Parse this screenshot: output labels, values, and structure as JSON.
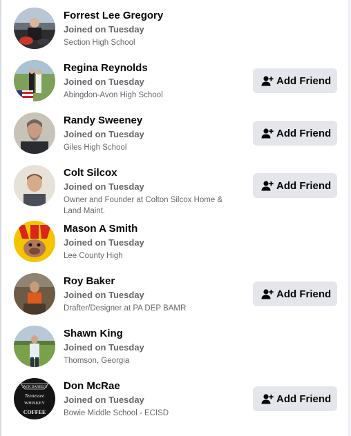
{
  "people": [
    {
      "name": "Forrest Lee Gregory",
      "joined": "Joined on Tuesday",
      "meta": "Section High School",
      "show_add": false,
      "add_label": "Add Friend"
    },
    {
      "name": "Regina Reynolds",
      "joined": "Joined on Tuesday",
      "meta": "Abingdon-Avon High School",
      "show_add": true,
      "add_label": "Add Friend"
    },
    {
      "name": "Randy Sweeney",
      "joined": "Joined on Tuesday",
      "meta": "Giles High School",
      "show_add": true,
      "add_label": "Add Friend"
    },
    {
      "name": "Colt Silcox",
      "joined": "Joined on Tuesday",
      "meta": "Owner and Founder at Colton Silcox Home & Land Maint.",
      "show_add": true,
      "add_label": "Add Friend"
    },
    {
      "name": "Mason A Smith",
      "joined": "Joined on Tuesday",
      "meta": "Lee County High",
      "show_add": false,
      "add_label": "Add Friend"
    },
    {
      "name": "Roy Baker",
      "joined": "Joined on Tuesday",
      "meta": "Drafter/Designer at PA DEP BAMR",
      "show_add": true,
      "add_label": "Add Friend"
    },
    {
      "name": "Shawn King",
      "joined": "Joined on Tuesday",
      "meta": "Thomson, Georgia",
      "show_add": false,
      "add_label": "Add Friend"
    },
    {
      "name": "Don McRae",
      "joined": "Joined on Tuesday",
      "meta": "Bowie Middle School - ECISD",
      "show_add": true,
      "add_label": "Add Friend"
    }
  ],
  "avatar_logo_text": {
    "line1": "JACK DANIEL'S",
    "line2": "Tennessee",
    "line3": "WHISKEY",
    "line4": "COFFEE"
  },
  "colors": {
    "button_bg": "#e4e6eb",
    "secondary_text": "#65676b",
    "primary_text": "#050505"
  },
  "icons": {
    "add_friend": "person-plus-icon"
  }
}
